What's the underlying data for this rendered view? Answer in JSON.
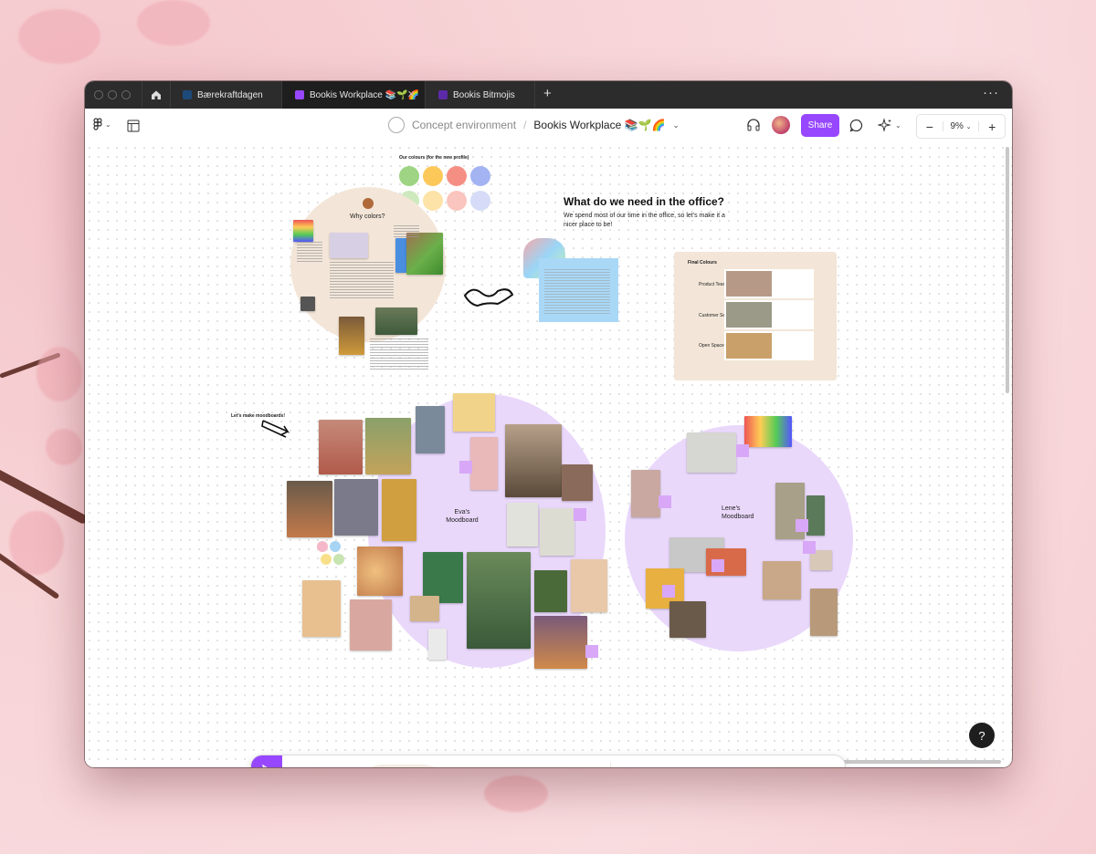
{
  "browser": {
    "tabs": [
      {
        "label": "Bærekraftdagen",
        "icon_color": "#1e4a7a",
        "active": false
      },
      {
        "label": "Bookis Workplace 📚🌱🌈",
        "icon_color": "#9747ff",
        "active": true
      },
      {
        "label": "Bookis Bitmojis",
        "icon_color": "#5b2aa6",
        "active": false
      }
    ],
    "new_tab_icon": "plus-icon",
    "more_icon": "more-icon"
  },
  "toolbar": {
    "project": "Concept environment",
    "separator": "/",
    "file_name": "Bookis Workplace 📚🌱🌈",
    "share_label": "Share",
    "zoom": "9%",
    "accent": "#9747ff"
  },
  "board": {
    "palette_title": "Our colours (for the new profile)",
    "palette_colors": [
      "#9ed483",
      "#fcc85a",
      "#f58f84",
      "#a4b3f2"
    ],
    "palette_light": [
      "#cfe9bf",
      "#fde3a8",
      "#fac5be",
      "#d6dcf7"
    ],
    "why_colors": "Why colors?",
    "office_title": "What do we need in the office?",
    "office_body": "We spend most of our time in the office, so let's make it a nicer place to be!",
    "eva_label": "Eva's Moodboard",
    "lene_label": "Lene's Moodboard",
    "moodboard_note": "Let's make moodboards!",
    "final_colours": "Final Colours",
    "zones": [
      {
        "label": "Product Team",
        "color": "#b69a87"
      },
      {
        "label": "Customer Service",
        "color": "#9b9a88"
      },
      {
        "label": "Open Space",
        "color": "#c99f6a"
      }
    ]
  },
  "bottom_toolbar": {
    "tools": [
      "pointer-tool",
      "hand-tool",
      "pen-tool",
      "shape-tool",
      "sticky-tool",
      "text-tool",
      "connector-tool",
      "section-tool",
      "stamp-tool",
      "more-tools"
    ],
    "help_label": "?"
  }
}
